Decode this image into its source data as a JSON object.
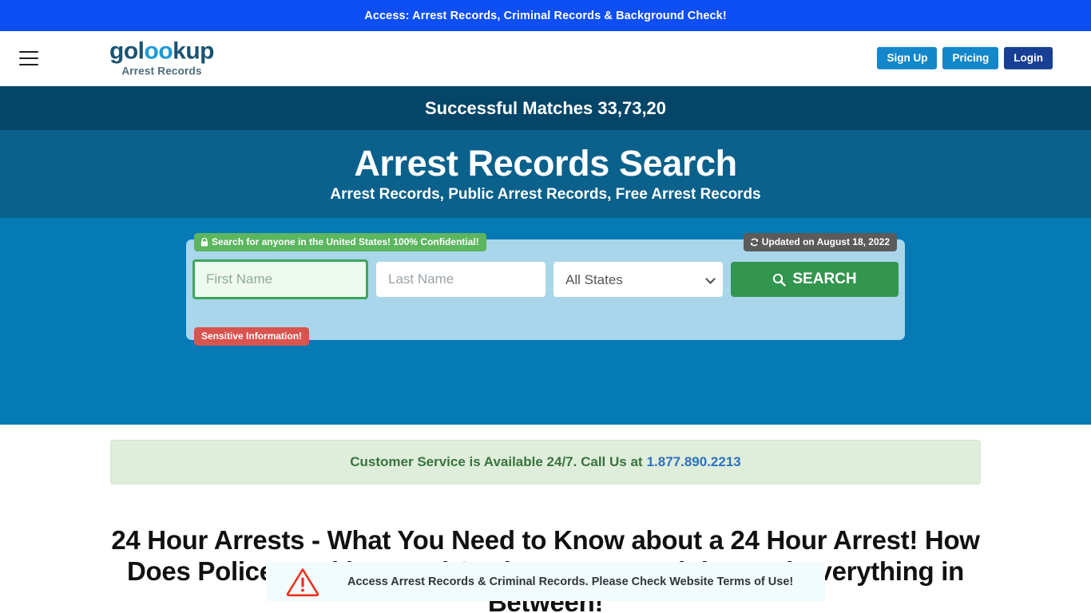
{
  "top_banner": {
    "text": "Access: Arrest Records, Criminal Records & Background Check!",
    "bg_color": "#0d4ef5"
  },
  "header": {
    "menu_icon": "hamburger-icon",
    "brand": {
      "name_part1": "gol",
      "name_arc": "oo",
      "name_part2": "kup",
      "full_name": "golookup",
      "subtitle": "Arrest Records"
    },
    "buttons": [
      {
        "label": "Sign Up",
        "color": "#1387c9"
      },
      {
        "label": "Pricing",
        "color": "#1387c9"
      },
      {
        "label": "Login",
        "color": "#173f94"
      }
    ]
  },
  "matches": {
    "text": "Successful Matches 33,73,20",
    "bg_color": "#054568"
  },
  "hero": {
    "title": "Arrest Records Search",
    "subtitle": "Arrest Records, Public Arrest Records, Free Arrest Records",
    "bg_color": "#0a618b"
  },
  "search": {
    "bg_color": "#057ab5",
    "panel_color": "#a9d6ea",
    "badge_confidential": {
      "icon": "lock-icon",
      "text": "Search for anyone in the United States! 100% Confidential!",
      "color": "#5cb55f"
    },
    "badge_updated": {
      "icon": "refresh-icon",
      "text": "Updated on August 18, 2022",
      "color": "#5b5b5b"
    },
    "badge_sensitive": {
      "text": "Sensitive Information!",
      "color": "#d9534f"
    },
    "first_name": {
      "placeholder": "First Name",
      "value": ""
    },
    "last_name": {
      "placeholder": "Last Name",
      "value": ""
    },
    "state_select": {
      "selected": "All States",
      "options": [
        "All States"
      ]
    },
    "search_button": {
      "label": "SEARCH",
      "icon": "search-icon",
      "color": "#33964f"
    }
  },
  "terms_alert": {
    "icon": "warning-triangle-icon",
    "text": "Access Arrest Records & Criminal Records. Please Check Website Terms of Use!"
  },
  "support": {
    "text": "Customer Service is Available 24/7. Call Us at",
    "phone": "1.877.890.2213",
    "phone_color": "#2f6fc4"
  },
  "article": {
    "title": "24 Hour Arrests - What You Need to Know about a 24 Hour Arrest! How Does Police Booking Work? What are Your Rights and Everything in Between!"
  }
}
